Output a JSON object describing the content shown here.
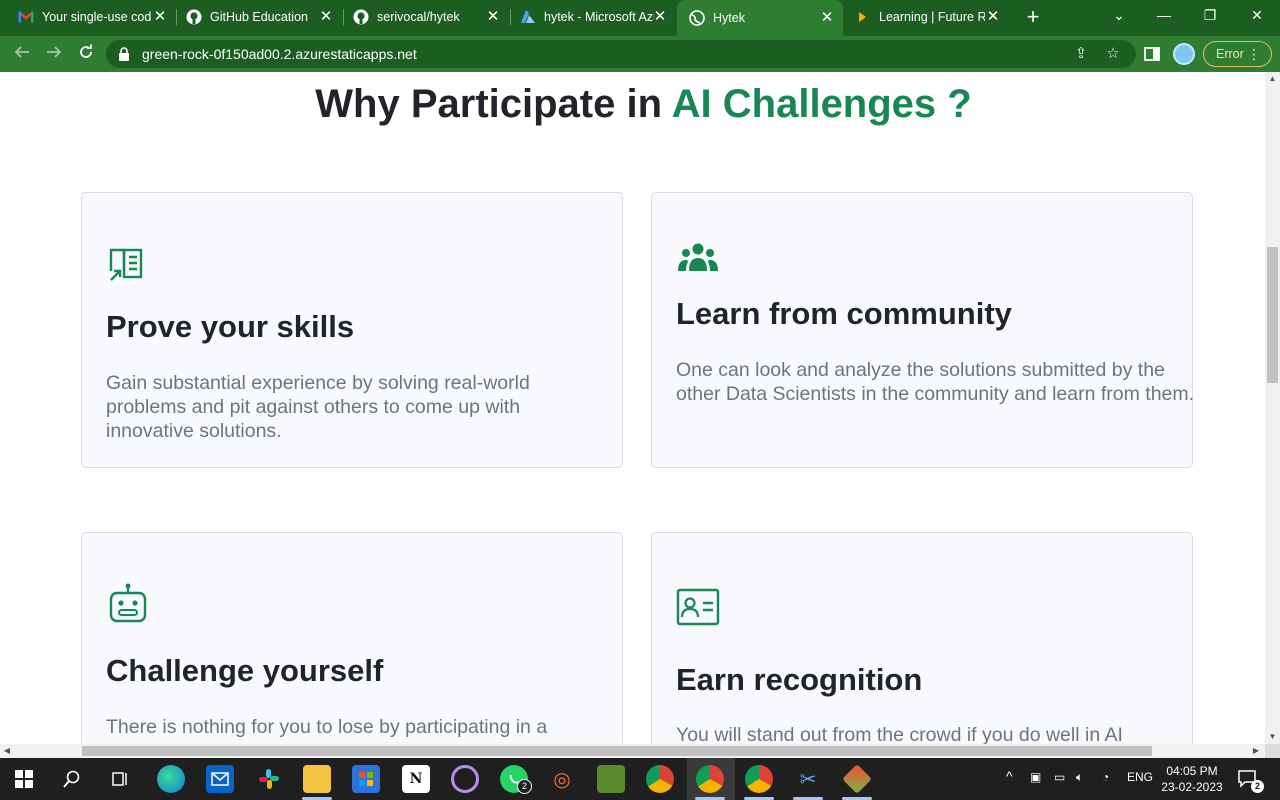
{
  "browser": {
    "tabs": [
      {
        "title": "Your single-use code",
        "icon": "gmail-icon"
      },
      {
        "title": "GitHub Education",
        "icon": "github-icon"
      },
      {
        "title": "serivocal/hytek",
        "icon": "github-icon"
      },
      {
        "title": "hytek - Microsoft Azure",
        "icon": "azure-icon"
      },
      {
        "title": "Hytek",
        "icon": "globe-icon",
        "active": true
      },
      {
        "title": "Learning | Future Ready",
        "icon": "learning-icon"
      }
    ],
    "url": "green-rock-0f150ad00.2.azurestaticapps.net",
    "error_label": "Error",
    "theme_color": "#2e7d32"
  },
  "page": {
    "heading_prefix": "Why Participate in ",
    "heading_accent": "AI Challenges ?",
    "accent_color": "#198754",
    "cards": [
      {
        "icon": "certificate-icon",
        "title": "Prove your skills",
        "description": "Gain substantial experience by solving real-world problems and pit against others to come up with innovative solutions."
      },
      {
        "icon": "people-icon",
        "title": "Learn from community",
        "description": "One can look and analyze the solutions submitted by the other Data Scientists in the community and learn from them."
      },
      {
        "icon": "robot-icon",
        "title": "Challenge yourself",
        "description": "There is nothing for you to lose by participating in a"
      },
      {
        "icon": "person-badge-icon",
        "title": "Earn recognition",
        "description": "You will stand out from the crowd if you do well in AI"
      }
    ]
  },
  "taskbar": {
    "whatsapp_badge": "2",
    "language": "ENG",
    "time": "04:05 PM",
    "date": "23-02-2023",
    "notification_count": "2"
  }
}
